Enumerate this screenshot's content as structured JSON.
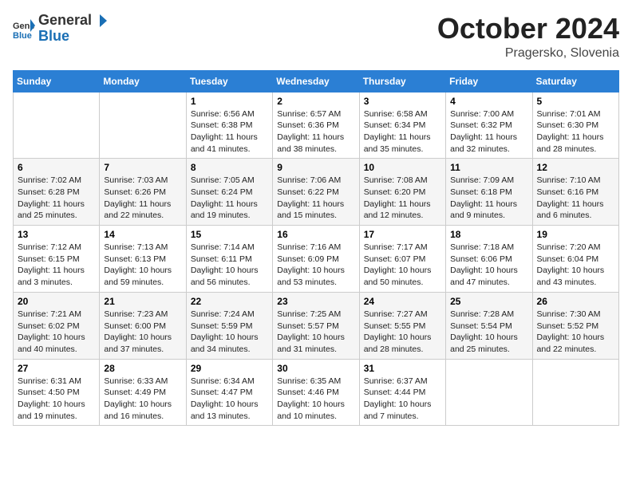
{
  "logo": {
    "text_general": "General",
    "text_blue": "Blue"
  },
  "header": {
    "month": "October 2024",
    "location": "Pragersko, Slovenia"
  },
  "weekdays": [
    "Sunday",
    "Monday",
    "Tuesday",
    "Wednesday",
    "Thursday",
    "Friday",
    "Saturday"
  ],
  "weeks": [
    [
      {
        "day": "",
        "info": ""
      },
      {
        "day": "",
        "info": ""
      },
      {
        "day": "1",
        "info": "Sunrise: 6:56 AM\nSunset: 6:38 PM\nDaylight: 11 hours and 41 minutes."
      },
      {
        "day": "2",
        "info": "Sunrise: 6:57 AM\nSunset: 6:36 PM\nDaylight: 11 hours and 38 minutes."
      },
      {
        "day": "3",
        "info": "Sunrise: 6:58 AM\nSunset: 6:34 PM\nDaylight: 11 hours and 35 minutes."
      },
      {
        "day": "4",
        "info": "Sunrise: 7:00 AM\nSunset: 6:32 PM\nDaylight: 11 hours and 32 minutes."
      },
      {
        "day": "5",
        "info": "Sunrise: 7:01 AM\nSunset: 6:30 PM\nDaylight: 11 hours and 28 minutes."
      }
    ],
    [
      {
        "day": "6",
        "info": "Sunrise: 7:02 AM\nSunset: 6:28 PM\nDaylight: 11 hours and 25 minutes."
      },
      {
        "day": "7",
        "info": "Sunrise: 7:03 AM\nSunset: 6:26 PM\nDaylight: 11 hours and 22 minutes."
      },
      {
        "day": "8",
        "info": "Sunrise: 7:05 AM\nSunset: 6:24 PM\nDaylight: 11 hours and 19 minutes."
      },
      {
        "day": "9",
        "info": "Sunrise: 7:06 AM\nSunset: 6:22 PM\nDaylight: 11 hours and 15 minutes."
      },
      {
        "day": "10",
        "info": "Sunrise: 7:08 AM\nSunset: 6:20 PM\nDaylight: 11 hours and 12 minutes."
      },
      {
        "day": "11",
        "info": "Sunrise: 7:09 AM\nSunset: 6:18 PM\nDaylight: 11 hours and 9 minutes."
      },
      {
        "day": "12",
        "info": "Sunrise: 7:10 AM\nSunset: 6:16 PM\nDaylight: 11 hours and 6 minutes."
      }
    ],
    [
      {
        "day": "13",
        "info": "Sunrise: 7:12 AM\nSunset: 6:15 PM\nDaylight: 11 hours and 3 minutes."
      },
      {
        "day": "14",
        "info": "Sunrise: 7:13 AM\nSunset: 6:13 PM\nDaylight: 10 hours and 59 minutes."
      },
      {
        "day": "15",
        "info": "Sunrise: 7:14 AM\nSunset: 6:11 PM\nDaylight: 10 hours and 56 minutes."
      },
      {
        "day": "16",
        "info": "Sunrise: 7:16 AM\nSunset: 6:09 PM\nDaylight: 10 hours and 53 minutes."
      },
      {
        "day": "17",
        "info": "Sunrise: 7:17 AM\nSunset: 6:07 PM\nDaylight: 10 hours and 50 minutes."
      },
      {
        "day": "18",
        "info": "Sunrise: 7:18 AM\nSunset: 6:06 PM\nDaylight: 10 hours and 47 minutes."
      },
      {
        "day": "19",
        "info": "Sunrise: 7:20 AM\nSunset: 6:04 PM\nDaylight: 10 hours and 43 minutes."
      }
    ],
    [
      {
        "day": "20",
        "info": "Sunrise: 7:21 AM\nSunset: 6:02 PM\nDaylight: 10 hours and 40 minutes."
      },
      {
        "day": "21",
        "info": "Sunrise: 7:23 AM\nSunset: 6:00 PM\nDaylight: 10 hours and 37 minutes."
      },
      {
        "day": "22",
        "info": "Sunrise: 7:24 AM\nSunset: 5:59 PM\nDaylight: 10 hours and 34 minutes."
      },
      {
        "day": "23",
        "info": "Sunrise: 7:25 AM\nSunset: 5:57 PM\nDaylight: 10 hours and 31 minutes."
      },
      {
        "day": "24",
        "info": "Sunrise: 7:27 AM\nSunset: 5:55 PM\nDaylight: 10 hours and 28 minutes."
      },
      {
        "day": "25",
        "info": "Sunrise: 7:28 AM\nSunset: 5:54 PM\nDaylight: 10 hours and 25 minutes."
      },
      {
        "day": "26",
        "info": "Sunrise: 7:30 AM\nSunset: 5:52 PM\nDaylight: 10 hours and 22 minutes."
      }
    ],
    [
      {
        "day": "27",
        "info": "Sunrise: 6:31 AM\nSunset: 4:50 PM\nDaylight: 10 hours and 19 minutes."
      },
      {
        "day": "28",
        "info": "Sunrise: 6:33 AM\nSunset: 4:49 PM\nDaylight: 10 hours and 16 minutes."
      },
      {
        "day": "29",
        "info": "Sunrise: 6:34 AM\nSunset: 4:47 PM\nDaylight: 10 hours and 13 minutes."
      },
      {
        "day": "30",
        "info": "Sunrise: 6:35 AM\nSunset: 4:46 PM\nDaylight: 10 hours and 10 minutes."
      },
      {
        "day": "31",
        "info": "Sunrise: 6:37 AM\nSunset: 4:44 PM\nDaylight: 10 hours and 7 minutes."
      },
      {
        "day": "",
        "info": ""
      },
      {
        "day": "",
        "info": ""
      }
    ]
  ]
}
